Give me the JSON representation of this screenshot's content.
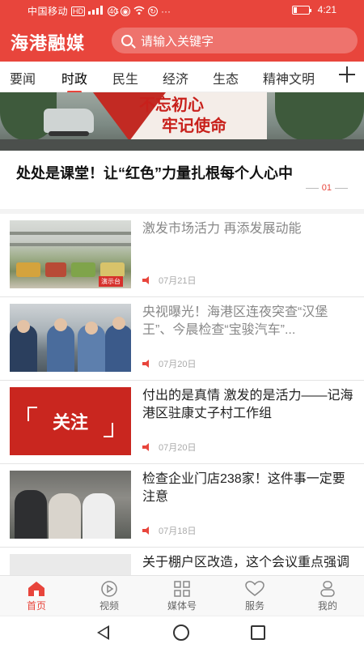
{
  "statusbar": {
    "carrier": "中国移动",
    "hd_badge": "HD",
    "net_badge": "4G",
    "battery_level": 0.2,
    "time": "4:21"
  },
  "header": {
    "brand": "海港融媒",
    "search_placeholder": "请输入关键字"
  },
  "tabs": [
    {
      "label": "要闻"
    },
    {
      "label": "时政",
      "active": true
    },
    {
      "label": "民生"
    },
    {
      "label": "经济"
    },
    {
      "label": "生态"
    },
    {
      "label": "精神文明"
    }
  ],
  "banner": {
    "slogan_line1": "不忘初心",
    "slogan_line2": "牢记使命",
    "headline": "处处是课堂！让“红色”力量扎根每个人心中",
    "page_indicator": "01"
  },
  "news": [
    {
      "title": "激发市场活力 再添发展动能",
      "date": "07月21日",
      "read": true,
      "thumb": "market",
      "thumb_sign": "演示台"
    },
    {
      "title": "央视曝光！海港区连夜突查“汉堡王”、今晨检查“宝骏汽车”...",
      "date": "07月20日",
      "read": true,
      "thumb": "kitchen"
    },
    {
      "title": "付出的是真情 激发的是活力——记海港区驻康丈子村工作组",
      "date": "07月20日",
      "read": false,
      "thumb": "focus",
      "thumb_text": "关注"
    },
    {
      "title": "检查企业门店238家！这件事一定要注意",
      "date": "07月18日",
      "read": false,
      "thumb": "chef"
    },
    {
      "title": "关于棚户区改造，这个会议重点强调",
      "date": "",
      "read": false,
      "thumb": "blank"
    }
  ],
  "bottom_nav": [
    {
      "label": "首页",
      "icon": "home-icon",
      "active": true
    },
    {
      "label": "视频",
      "icon": "video-icon"
    },
    {
      "label": "媒体号",
      "icon": "grid-icon"
    },
    {
      "label": "服务",
      "icon": "heart-icon"
    },
    {
      "label": "我的",
      "icon": "person-icon"
    }
  ],
  "colors": {
    "accent": "#e8453c"
  }
}
